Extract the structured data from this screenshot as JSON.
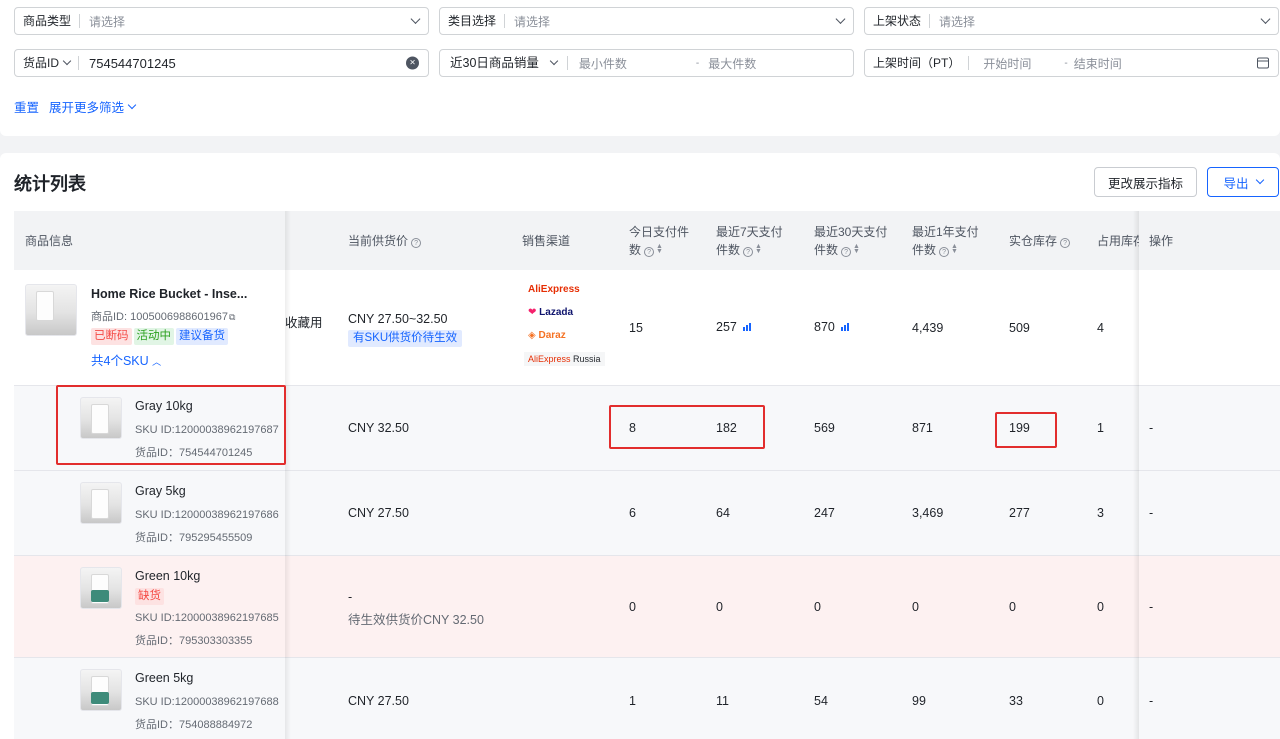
{
  "filters": {
    "row1": [
      {
        "label": "商品类型",
        "placeholder": "请选择"
      },
      {
        "label": "类目选择",
        "placeholder": "请选择"
      },
      {
        "label": "上架状态",
        "placeholder": "请选择"
      }
    ],
    "goods_id": {
      "type_label": "货品ID",
      "value": "754544701245"
    },
    "sales": {
      "label": "近30日商品销量",
      "min_placeholder": "最小件数",
      "separator": "-",
      "max_placeholder": "最大件数"
    },
    "listing_time": {
      "label": "上架时间（PT）",
      "start_placeholder": "开始时间",
      "separator": "-",
      "end_placeholder": "结束时间"
    },
    "reset": "重置",
    "expand": "展开更多筛选"
  },
  "list": {
    "title": "统计列表",
    "change_metrics_button": "更改展示指标",
    "export_button": "导出",
    "columns": {
      "product_info": "商品信息",
      "current_price": "当前供货价",
      "channel": "销售渠道",
      "today_paid": [
        "今日支付件",
        "数"
      ],
      "paid_7d": [
        "最近7天支付",
        "件数"
      ],
      "paid_30d": [
        "最近30天支付",
        "件数"
      ],
      "paid_1y": [
        "最近1年支付",
        "件数"
      ],
      "stock": "实仓库存",
      "occupied": "占用库存",
      "action": "操作"
    },
    "product": {
      "name": "Home Rice Bucket - Inse...",
      "id_label": "商品ID:",
      "id": "1005006988601967",
      "tags": [
        "已断码",
        "活动中",
        "建议备货"
      ],
      "sku_toggle": "共4个SKU",
      "side_text": "收藏用",
      "price": "CNY 27.50~32.50",
      "price_tag": "有SKU供货价待生效",
      "channels": [
        "AliExpress",
        "Lazada",
        "Daraz",
        "AliExpress",
        "Russia"
      ],
      "today": "15",
      "d7": "257",
      "d30": "870",
      "y1": "4,439",
      "stock": "509",
      "occupied": "4"
    },
    "skus": [
      {
        "name": "Gray 10kg",
        "tag": "",
        "sku_id": "SKU ID:12000038962197687",
        "goods_id": "货品ID：754544701245",
        "price": "CNY 32.50",
        "price_sub": "",
        "today": "8",
        "d7": "182",
        "d30": "569",
        "y1": "871",
        "stock": "199",
        "occupied": "1",
        "action": "-",
        "color": "gray"
      },
      {
        "name": "Gray 5kg",
        "tag": "",
        "sku_id": "SKU ID:12000038962197686",
        "goods_id": "货品ID：795295455509",
        "price": "CNY 27.50",
        "price_sub": "",
        "today": "6",
        "d7": "64",
        "d30": "247",
        "y1": "3,469",
        "stock": "277",
        "occupied": "3",
        "action": "-",
        "color": "gray"
      },
      {
        "name": "Green 10kg",
        "tag": "缺货",
        "sku_id": "SKU ID:12000038962197685",
        "goods_id": "货品ID：795303303355",
        "price": "-",
        "price_sub": "待生效供货价CNY 32.50",
        "today": "0",
        "d7": "0",
        "d30": "0",
        "y1": "0",
        "stock": "0",
        "occupied": "0",
        "action": "-",
        "color": "green"
      },
      {
        "name": "Green 5kg",
        "tag": "",
        "sku_id": "SKU ID:12000038962197688",
        "goods_id": "货品ID：754088884972",
        "price": "CNY 27.50",
        "price_sub": "",
        "today": "1",
        "d7": "11",
        "d30": "54",
        "y1": "99",
        "stock": "33",
        "occupied": "0",
        "action": "-",
        "color": "green"
      }
    ]
  },
  "colors": {
    "accent": "#1664ff",
    "highlight_border": "#e22d2d",
    "out_of_stock_row": "#fdf1f1"
  }
}
